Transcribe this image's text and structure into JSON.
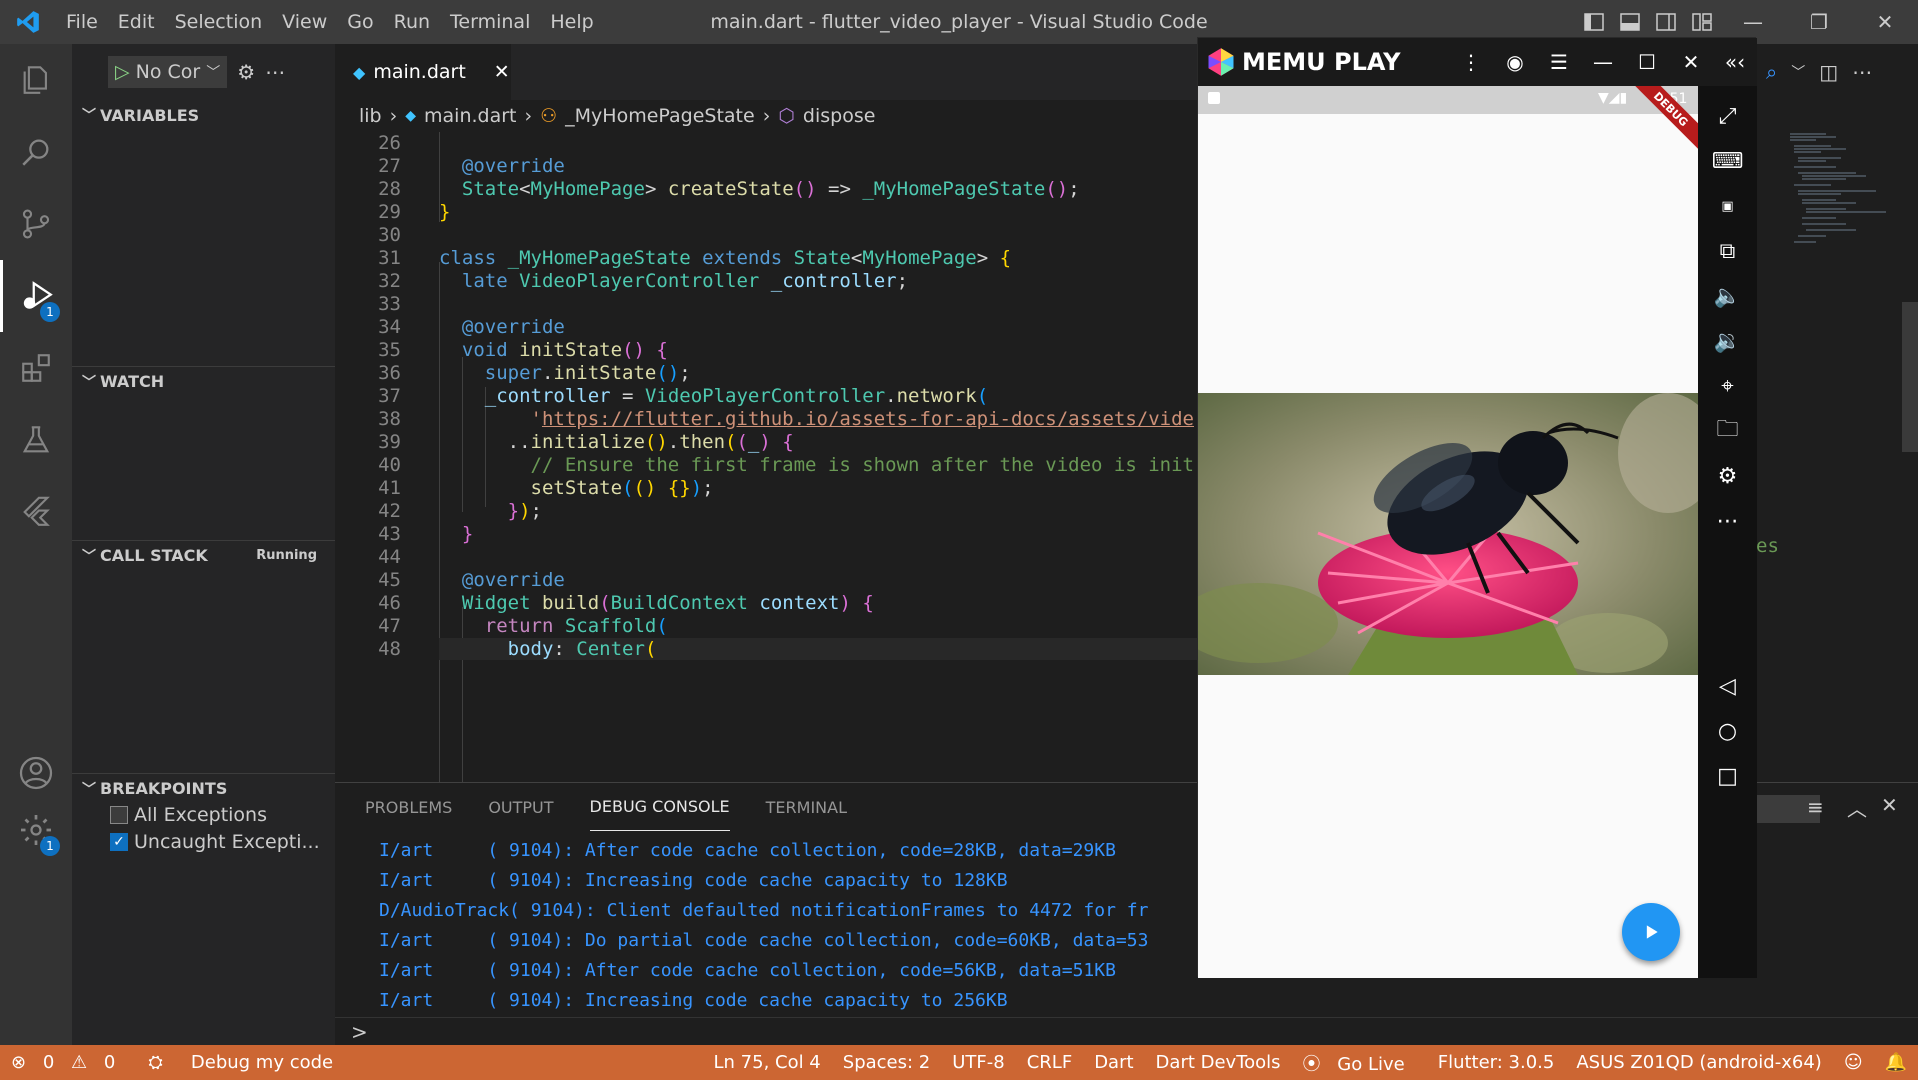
{
  "titlebar": {
    "menu": [
      "File",
      "Edit",
      "Selection",
      "View",
      "Go",
      "Run",
      "Terminal",
      "Help"
    ],
    "title": "main.dart - flutter_video_player - Visual Studio Code"
  },
  "sidebar": {
    "run_config": "No Cor",
    "sections": {
      "variables": "VARIABLES",
      "watch": "WATCH",
      "callstack": "CALL STACK",
      "callstack_status": "Running",
      "breakpoints": "BREAKPOINTS"
    },
    "breakpoints": [
      {
        "label": "All Exceptions",
        "checked": false
      },
      {
        "label": "Uncaught Excepti...",
        "checked": true
      }
    ]
  },
  "activity_badges": {
    "debug": "1",
    "settings": "1"
  },
  "tab": {
    "label": "main.dart",
    "close": "✕"
  },
  "breadcrumb": {
    "lib": "lib",
    "file": "main.dart",
    "class": "_MyHomePageState",
    "method": "dispose"
  },
  "code_lines": [
    "26",
    "27",
    "28",
    "29",
    "30",
    "31",
    "32",
    "33",
    "34",
    "35",
    "36",
    "37",
    "38",
    "39",
    "40",
    "41",
    "42",
    "43",
    "44",
    "45",
    "46",
    "47",
    "48"
  ],
  "panel": {
    "tabs": [
      "PROBLEMS",
      "OUTPUT",
      "DEBUG CONSOLE",
      "TERMINAL"
    ],
    "active": "DEBUG CONSOLE",
    "log": [
      "I/art     ( 9104): After code cache collection, code=28KB, data=29KB",
      "I/art     ( 9104): Increasing code cache capacity to 128KB",
      "D/AudioTrack( 9104): Client defaulted notificationFrames to 4472 for fr",
      "I/art     ( 9104): Do partial code cache collection, code=60KB, data=53",
      "I/art     ( 9104): After code cache collection, code=56KB, data=51KB",
      "I/art     ( 9104): Increasing code cache capacity to 256KB"
    ],
    "prompt": ">"
  },
  "statusbar": {
    "errors": "0",
    "warnings": "0",
    "debug": "Debug my code",
    "position": "Ln 75, Col 4",
    "spaces": "Spaces: 2",
    "encoding": "UTF-8",
    "eol": "CRLF",
    "language": "Dart",
    "devtools": "Dart DevTools",
    "golive": "Go Live",
    "flutter": "Flutter: 3.0.5",
    "device": "ASUS Z01QD (android-x64)"
  },
  "memu": {
    "brand": "MEMU PLAY",
    "clock": "9:51",
    "debug_ribbon": "DEBUG"
  },
  "colors": {
    "statusbar": "#cc6633",
    "accent": "#0e70c0",
    "fab": "#2196f3"
  }
}
